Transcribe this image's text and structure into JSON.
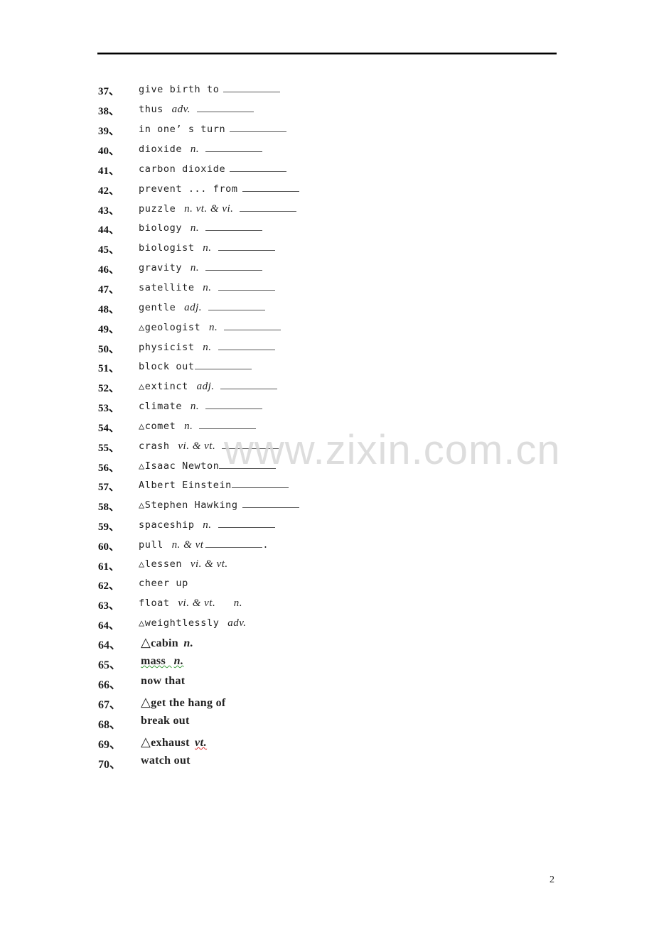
{
  "document": {
    "page_number": "2",
    "watermark": "www.zixin.com.cn",
    "separator": "、",
    "triangle_marker": "△",
    "entries": [
      {
        "num": "37",
        "term": "give birth to",
        "pos": "",
        "blank": true
      },
      {
        "num": "38",
        "term": "thus",
        "pos": "adv.",
        "blank": true
      },
      {
        "num": "39",
        "term": "in one’ s turn",
        "pos": "",
        "blank": true
      },
      {
        "num": "40",
        "term": "dioxide",
        "pos": "n.",
        "blank": true
      },
      {
        "num": "41",
        "term": "carbon dioxide",
        "pos": "",
        "blank": true
      },
      {
        "num": "42",
        "term": "prevent ... from",
        "pos": "",
        "blank": true
      },
      {
        "num": "43",
        "term": "puzzle",
        "pos": "n.  vt. & vi.",
        "blank": true
      },
      {
        "num": "44",
        "term": "biology",
        "pos": "n.",
        "blank": true
      },
      {
        "num": "45",
        "term": "biologist",
        "pos": "n.",
        "blank": true
      },
      {
        "num": "46",
        "term": "gravity",
        "pos": "n.",
        "blank": true
      },
      {
        "num": "47",
        "term": "satellite",
        "pos": "n.",
        "blank": true
      },
      {
        "num": "48",
        "term": "gentle",
        "pos": "adj.",
        "blank": true
      },
      {
        "num": "49",
        "term": "△geologist",
        "pos": "n.",
        "blank": true
      },
      {
        "num": "50",
        "term": "physicist",
        "pos": "n.",
        "blank": true
      },
      {
        "num": "51",
        "term": "block out",
        "pos": "",
        "blank": true
      },
      {
        "num": "52",
        "term": "△extinct",
        "pos": "adj.",
        "blank": true
      },
      {
        "num": "53",
        "term": "climate",
        "pos": "n.",
        "blank": true
      },
      {
        "num": "54",
        "term": "△comet",
        "pos": "n.",
        "blank": true
      },
      {
        "num": "55",
        "term": "crash",
        "pos": "vi. & vt.",
        "blank": true
      },
      {
        "num": "56",
        "term": "△Isaac Newton",
        "pos": "",
        "blank": true
      },
      {
        "num": "57",
        "term": "Albert Einstein",
        "pos": "",
        "blank": true
      },
      {
        "num": "58",
        "term": "△Stephen Hawking",
        "pos": "",
        "blank": true
      },
      {
        "num": "59",
        "term": "spaceship",
        "pos": "n.",
        "blank": true
      },
      {
        "num": "60",
        "term": "pull",
        "pos": "n. & vt",
        "blank": true,
        "suffix": "."
      },
      {
        "num": "61",
        "term": "△lessen",
        "pos": "vi. & vt.",
        "blank": false
      },
      {
        "num": "62",
        "term": "cheer up",
        "pos": "",
        "blank": false
      },
      {
        "num": "63",
        "term": "float",
        "pos": "vi. & vt.      n.",
        "blank": false
      },
      {
        "num": "64",
        "term": "△weightlessly",
        "pos": "adv.",
        "blank": false
      }
    ],
    "bold_entries": [
      {
        "num": "64",
        "marker": "△",
        "term": "cabin",
        "pos": "n."
      },
      {
        "num": "65",
        "marker": "",
        "term": "mass",
        "pos": "n."
      },
      {
        "num": "66",
        "marker": "",
        "term": "now that",
        "pos": ""
      },
      {
        "num": "67",
        "marker": "△",
        "term": "get the hang of",
        "pos": ""
      },
      {
        "num": "68",
        "marker": "",
        "term": "break out",
        "pos": ""
      },
      {
        "num": "69",
        "marker": "△",
        "term": "exhaust",
        "pos": "vt."
      },
      {
        "num": "70",
        "marker": "",
        "term": "watch out",
        "pos": ""
      }
    ]
  }
}
